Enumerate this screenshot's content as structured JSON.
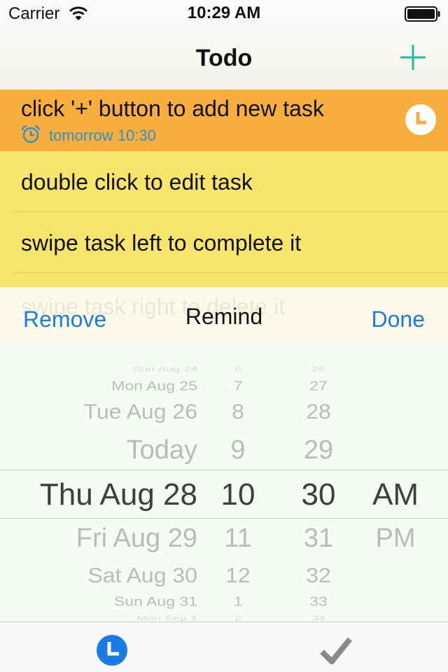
{
  "status_bar": {
    "carrier": "Carrier",
    "time": "10:29 AM",
    "icons": [
      "wifi-icon",
      "battery-icon"
    ]
  },
  "nav": {
    "title": "Todo",
    "add_icon": "plus-icon",
    "accent_color": "#1fbf9a"
  },
  "tasks": [
    {
      "text": "click '+' button to add new task",
      "reminder": "tomorrow 10:30",
      "active": true,
      "background": "#f8ae3d",
      "icons": [
        "alarm-clock-icon",
        "clock-icon"
      ]
    },
    {
      "text": "double click to edit task"
    },
    {
      "text": "swipe task left to complete it"
    },
    {
      "text": "swipe task right to delete it"
    }
  ],
  "list_color": "#f6e56a",
  "reminder_sheet": {
    "remove_label": "Remove",
    "title": "Remind",
    "done_label": "Done",
    "link_color": "#1a7ae6",
    "picker": {
      "dates": [
        "Sun Aug 24",
        "Mon Aug 25",
        "Tue Aug 26",
        "Today",
        "Thu Aug 28",
        "Fri Aug 29",
        "Sat Aug 30",
        "Sun Aug 31",
        "Mon Sep 1"
      ],
      "hours": [
        "6",
        "7",
        "8",
        "9",
        "10",
        "11",
        "12",
        "1",
        "2"
      ],
      "minutes": [
        "26",
        "27",
        "28",
        "29",
        "30",
        "31",
        "32",
        "33",
        "34"
      ],
      "ampm": [
        "AM",
        "PM"
      ],
      "selected": {
        "date": "Thu Aug 28",
        "hour": "10",
        "minute": "30",
        "ampm": "AM"
      }
    }
  },
  "tab_bar": {
    "tabs": [
      {
        "icon": "clock-icon",
        "selected": true,
        "color": "#1a7ae6"
      },
      {
        "icon": "checkmark-icon",
        "selected": false,
        "color": "#8a8a8a"
      }
    ]
  }
}
